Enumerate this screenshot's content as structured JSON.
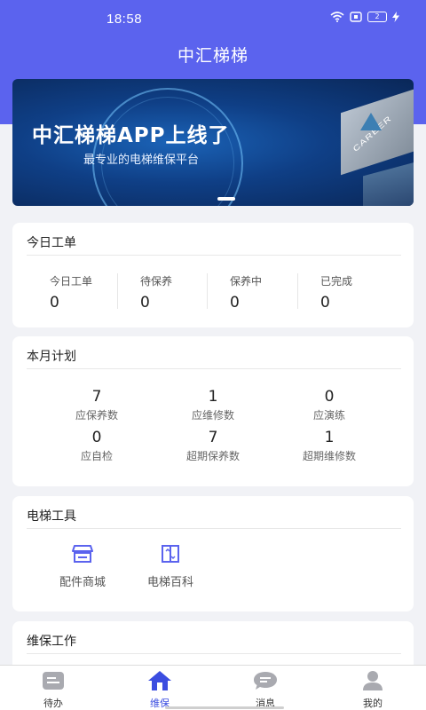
{
  "status_bar": {
    "time": "18:58",
    "battery_level": "2"
  },
  "header": {
    "title": "中汇梯梯"
  },
  "banner": {
    "headline": "中汇梯梯APP上线了",
    "subtitle": "最专业的电梯维保平台",
    "badge_text": "CAREER"
  },
  "today_orders": {
    "title": "今日工单",
    "stats": [
      {
        "label": "今日工单",
        "value": "0"
      },
      {
        "label": "待保养",
        "value": "0"
      },
      {
        "label": "保养中",
        "value": "0"
      },
      {
        "label": "已完成",
        "value": "0"
      }
    ]
  },
  "monthly_plan": {
    "title": "本月计划",
    "items": [
      {
        "value": "7",
        "label": "应保养数"
      },
      {
        "value": "1",
        "label": "应维修数"
      },
      {
        "value": "0",
        "label": "应演练"
      },
      {
        "value": "0",
        "label": "应自检"
      },
      {
        "value": "7",
        "label": "超期保养数"
      },
      {
        "value": "1",
        "label": "超期维修数"
      }
    ]
  },
  "elevator_tools": {
    "title": "电梯工具",
    "tools": [
      {
        "label": "配件商城",
        "icon": "store-icon"
      },
      {
        "label": "电梯百科",
        "icon": "elevator-icon"
      }
    ]
  },
  "maintenance_work": {
    "title": "维保工作"
  },
  "tabbar": {
    "tabs": [
      {
        "label": "待办",
        "icon": "todo-icon"
      },
      {
        "label": "维保",
        "icon": "home-icon",
        "active": true
      },
      {
        "label": "消息",
        "icon": "message-icon"
      },
      {
        "label": "我的",
        "icon": "user-icon"
      }
    ]
  },
  "colors": {
    "primary": "#5b63ee",
    "active_tab": "#3b4de0"
  }
}
